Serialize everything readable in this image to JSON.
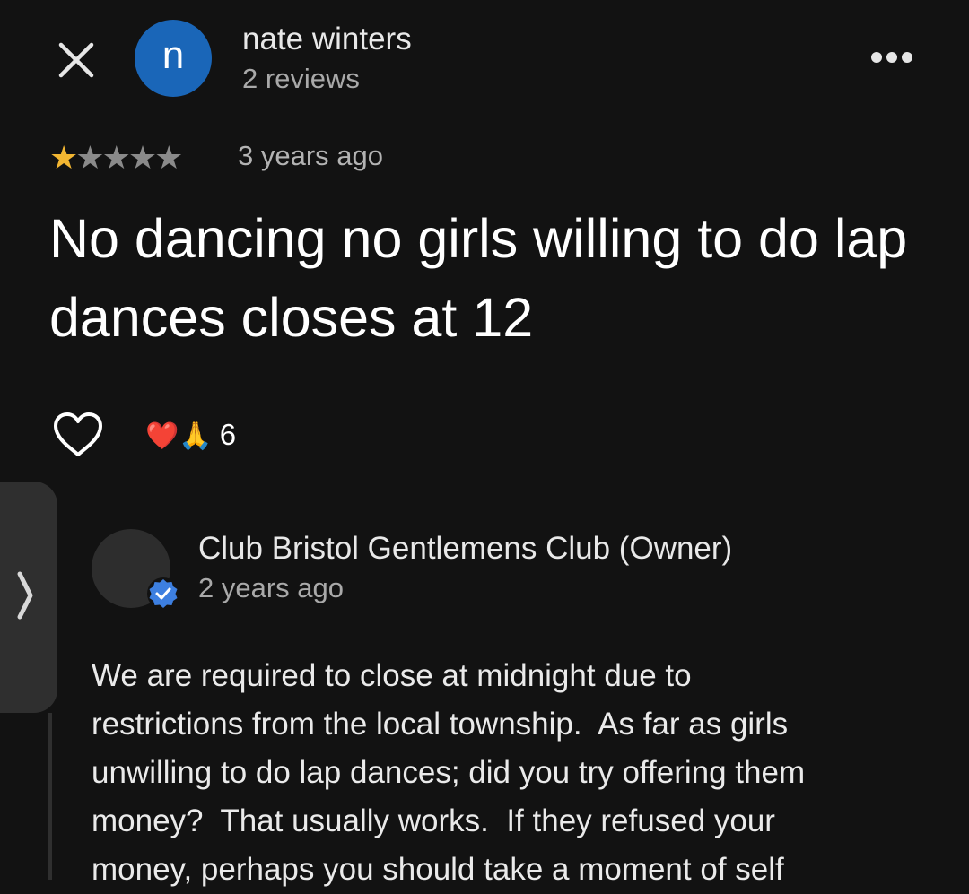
{
  "header": {
    "close_icon": "close-icon",
    "avatar_letter": "n",
    "avatar_color": "#1a66b8",
    "reviewer_name": "nate winters",
    "review_count": "2 reviews",
    "more_icon": "more-horizontal-icon"
  },
  "review": {
    "rating": 1,
    "rating_max": 5,
    "star_color": "#f2b632",
    "time": "3 years ago",
    "text": "No dancing no girls willing to do lap dances closes at 12"
  },
  "reactions": {
    "like_icon": "heart-outline-icon",
    "emojis": "❤️🙏",
    "count": "6"
  },
  "owner_reply": {
    "name": "Club Bristol Gentlemens Club (Owner)",
    "time": "2 years ago",
    "verified_icon": "verified-badge-icon",
    "text": "We are required to close at midnight due to\nrestrictions from the local township.  As far as girls\nunwilling to do lap dances; did you try offering them\nmoney?  That usually works.  If they refused your\nmoney, perhaps you should take a moment of self"
  },
  "side_tab": {
    "icon": "chevron-right-icon"
  }
}
